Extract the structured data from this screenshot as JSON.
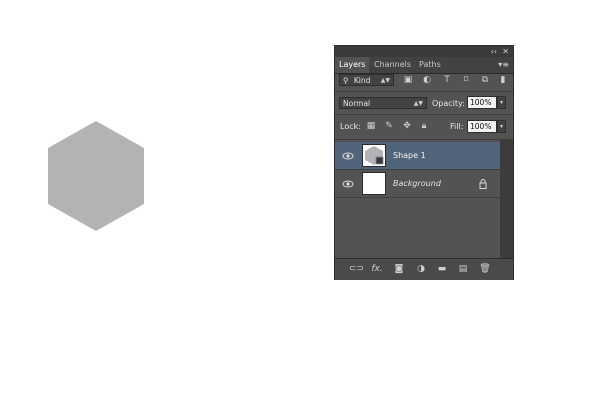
{
  "panel": {
    "collapse_glyph": "‹‹",
    "close_glyph": "✕",
    "menu_glyph": "▾≡",
    "tabs": [
      {
        "label": "Layers",
        "active": true
      },
      {
        "label": "Channels",
        "active": false
      },
      {
        "label": "Paths",
        "active": false
      }
    ]
  },
  "filter": {
    "kind_label": "Kind",
    "search_glyph": "⚲",
    "icons": [
      "image-filter-icon",
      "adjustment-filter-icon",
      "type-filter-icon",
      "shape-filter-icon",
      "smart-object-filter-icon"
    ]
  },
  "blend": {
    "mode": "Normal",
    "opacity_label": "Opacity:",
    "opacity_value": "100%"
  },
  "lock": {
    "label": "Lock:",
    "fill_label": "Fill:",
    "fill_value": "100%"
  },
  "layers": [
    {
      "name": "Shape 1",
      "selected": true,
      "visible": true,
      "type": "shape"
    },
    {
      "name": "Background",
      "selected": false,
      "visible": true,
      "type": "background",
      "locked": true
    }
  ],
  "bottom_bar": {
    "fx_label": "fx.",
    "icons": [
      "link-layers-icon",
      "fx-icon",
      "add-mask-icon",
      "new-adjustment-icon",
      "new-group-icon",
      "new-layer-icon",
      "delete-layer-icon"
    ]
  },
  "colors": {
    "canvas_shape_fill": "#b3b3b3",
    "panel_bg": "#535353",
    "selected_row": "#52647b"
  }
}
